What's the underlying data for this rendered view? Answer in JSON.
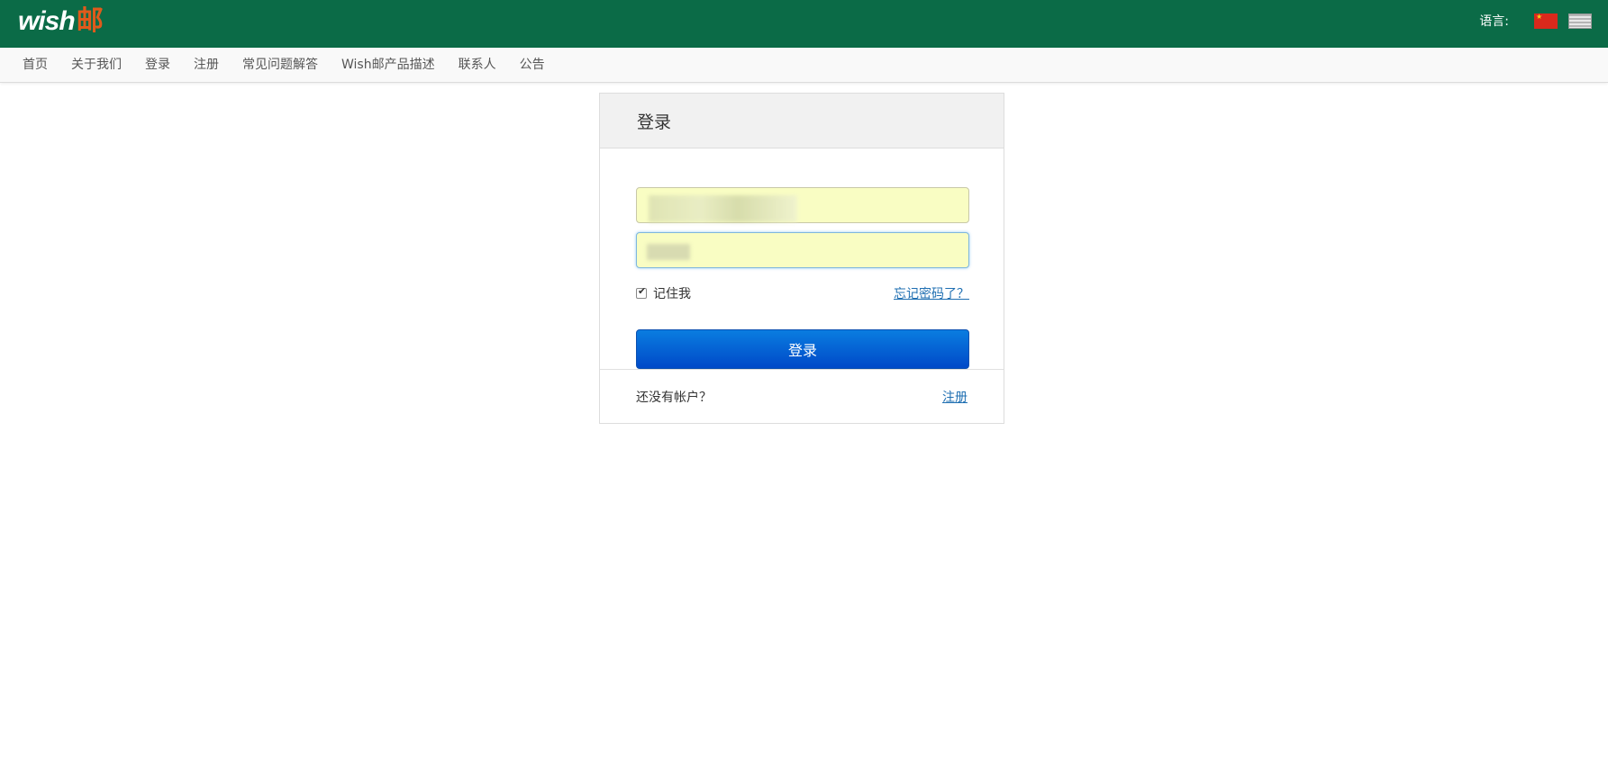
{
  "header": {
    "logo_text": "wish",
    "logo_cn": "邮",
    "language_label": "语言:",
    "flags": [
      "china-flag-icon",
      "usa-flag-icon"
    ],
    "bg_color": "#0b6b47",
    "logo_accent": "#e05a1b"
  },
  "nav": {
    "items": [
      "首页",
      "关于我们",
      "登录",
      "注册",
      "常见问题解答",
      "Wish邮产品描述",
      "联系人",
      "公告"
    ]
  },
  "login_panel": {
    "title": "登录",
    "username_value": "",
    "password_value": "",
    "remember_label": "记住我",
    "remember_checked": true,
    "forgot_link": "忘记密码了？",
    "submit_label": "登录",
    "no_account_text": "还没有帐户？",
    "register_link": "注册",
    "button_color": "#0a63d6",
    "link_color": "#1f6fb2",
    "autofill_color": "#f9fdc3"
  }
}
